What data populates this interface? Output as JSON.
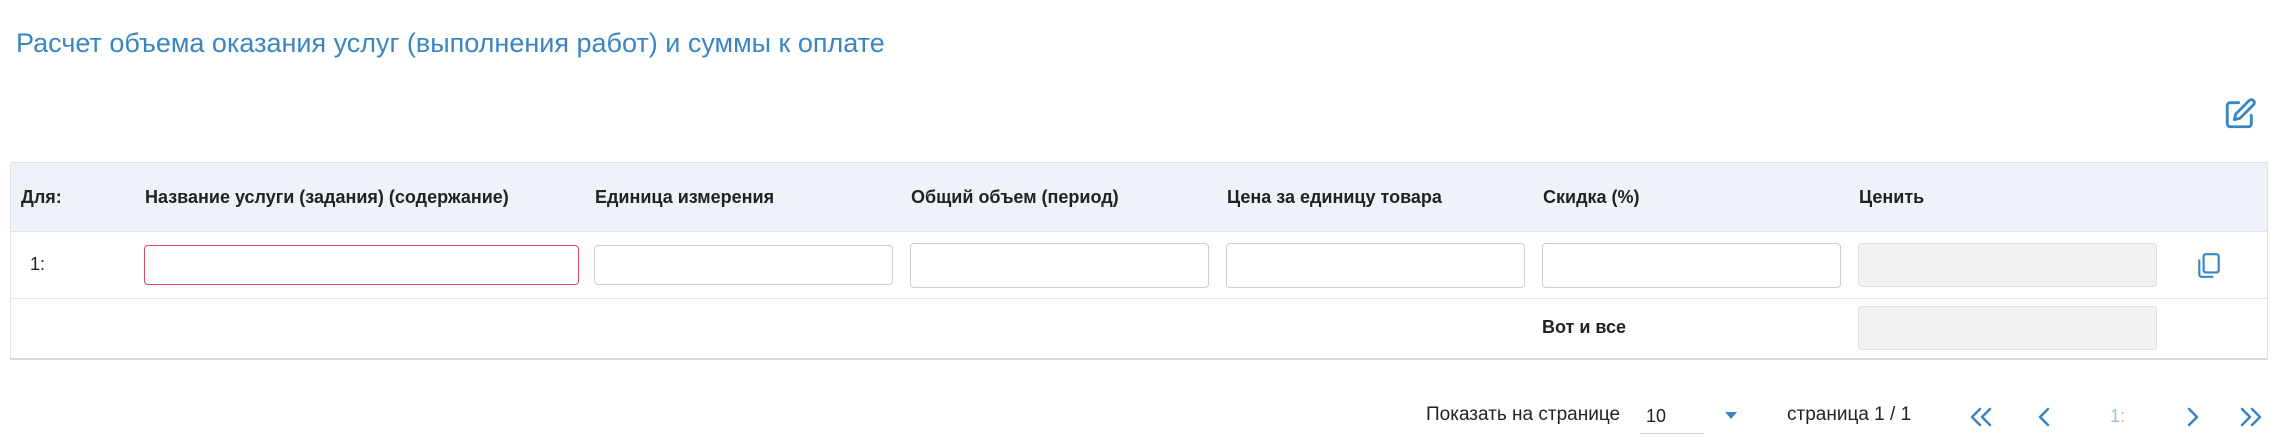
{
  "page": {
    "title": "Расчет объема оказания услуг (выполнения работ) и суммы к оплате"
  },
  "icons": {
    "edit": "edit-icon",
    "copy": "copy-icon",
    "caret": "chevron-down-icon",
    "first": "double-chevron-left-icon",
    "prev": "chevron-left-icon",
    "next": "chevron-right-icon",
    "last": "double-chevron-right-icon"
  },
  "colors": {
    "accent": "#3a85c2",
    "header_bg": "#eef3f9",
    "error_border": "#d9485f",
    "disabled_bg": "#f1f2f4"
  },
  "table": {
    "columns": [
      "Для:",
      "Название услуги (задания) (содержание)",
      "Единица измерения",
      "Общий объем (период)",
      "Цена за единицу товара",
      "Скидка (%)",
      "Ценить"
    ],
    "rows": [
      {
        "num": "1:",
        "service": "",
        "unit": "",
        "volume": "",
        "price": "",
        "discount": "",
        "value": ""
      }
    ],
    "total_label": "Вот и все",
    "total_value": ""
  },
  "pagination": {
    "show_label": "Показать на странице",
    "page_size": "10",
    "page_info": "страница 1 / 1",
    "current_page": "1:"
  }
}
